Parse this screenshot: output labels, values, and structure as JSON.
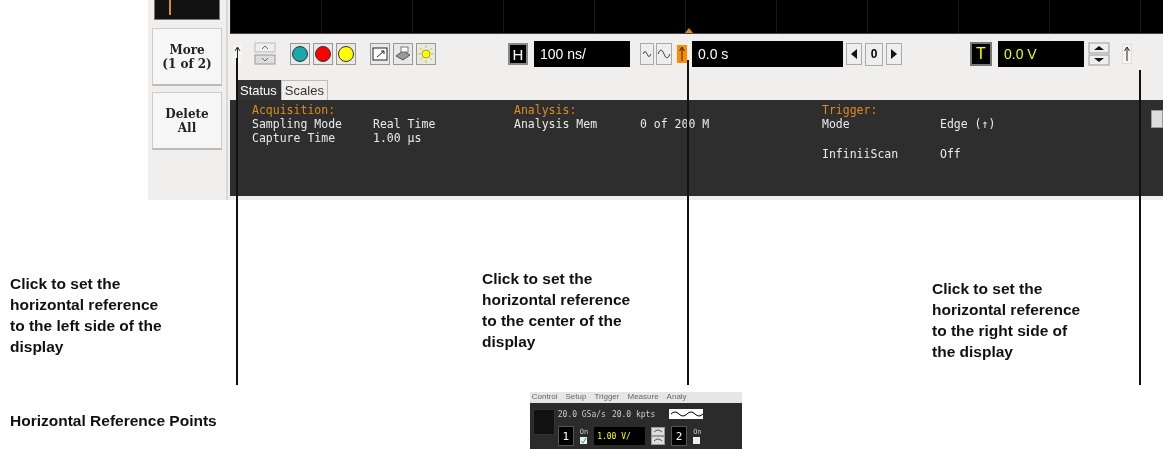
{
  "side_buttons": [
    {
      "lines": [
        "More",
        "(1 of 2)"
      ]
    },
    {
      "lines": [
        "Delete",
        "All"
      ]
    }
  ],
  "toolbar": {
    "horizontal_label": "H",
    "time_per_div": "100 ns/",
    "position": "0.0 s",
    "step_value": "0",
    "trigger_label": "T",
    "trigger_level": "0.0 V"
  },
  "reference_markers": [
    {
      "selected": false
    },
    {
      "selected": true
    },
    {
      "selected": false
    }
  ],
  "tabs": [
    {
      "label": "Status",
      "selected": true
    },
    {
      "label": "Scales",
      "selected": false
    }
  ],
  "status_sections": [
    {
      "title": "Acquisition:",
      "groups": [
        [
          {
            "name": "Sampling Mode",
            "value": "Real Time"
          },
          {
            "name": "Capture Time",
            "value": "1.00 µs"
          }
        ]
      ]
    },
    {
      "title": "Analysis:",
      "groups": [
        [
          {
            "name": "Analysis Mem",
            "value": "0 of 200 M"
          }
        ]
      ]
    },
    {
      "title": "Trigger:",
      "groups": [
        [
          {
            "name": "Mode",
            "value": "Edge (↑)"
          }
        ],
        [
          {
            "name": "InfiniiScan",
            "value": "Off"
          }
        ]
      ]
    }
  ],
  "callouts": [
    {
      "lines": [
        "Click to set the",
        "horizontal reference",
        "to the left side of the",
        "display"
      ]
    },
    {
      "lines": [
        "Click to set the",
        "horizontal reference",
        "to the center of the",
        "display"
      ]
    },
    {
      "lines": [
        "Click to set the",
        "horizontal reference",
        "to the right side of",
        "the display"
      ]
    }
  ],
  "figure_caption": "Horizontal Reference Points",
  "thumbnail": {
    "menu": [
      "Control",
      "Setup",
      "Trigger",
      "Measure",
      "Analy"
    ],
    "sample_rate": "20.0 GSa/s",
    "points": "20.0 kpts",
    "channels": [
      {
        "number": "1",
        "label": "On",
        "scale": "1.00 V/",
        "checked": true
      },
      {
        "number": "2",
        "label": "On",
        "checked": false
      }
    ]
  }
}
